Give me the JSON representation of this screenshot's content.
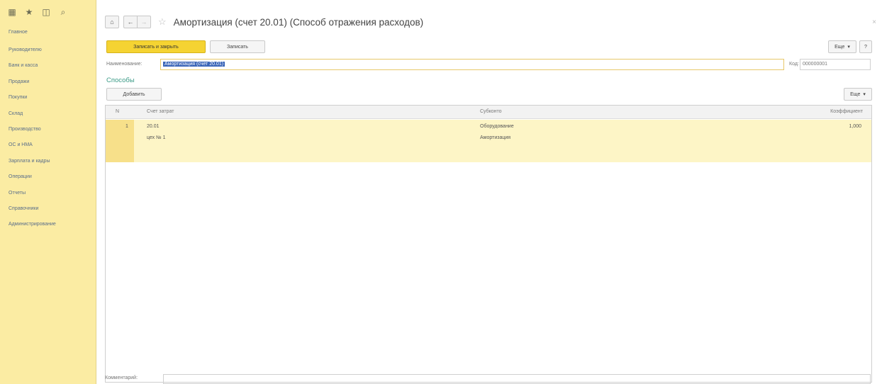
{
  "sidebar": {
    "items": [
      {
        "label": "Главное"
      },
      {
        "label": "Руководителю"
      },
      {
        "label": "Банк и касса"
      },
      {
        "label": "Продажи"
      },
      {
        "label": "Покупки"
      },
      {
        "label": "Склад"
      },
      {
        "label": "Производство"
      },
      {
        "label": "ОС и НМА"
      },
      {
        "label": "Зарплата и кадры"
      },
      {
        "label": "Операции"
      },
      {
        "label": "Отчеты"
      },
      {
        "label": "Справочники"
      },
      {
        "label": "Администрирование"
      }
    ]
  },
  "header": {
    "title": "Амортизация (счет 20.01) (Способ отражения расходов)",
    "home_glyph": "⌂",
    "back_glyph": "←",
    "forward_glyph": "→",
    "star_glyph": "☆",
    "close_glyph": "×"
  },
  "toolbar": {
    "save_close_label": "Записать и закрыть",
    "save_label": "Записать",
    "more_label": "Еще",
    "more_arrow": "▾",
    "help_label": "?"
  },
  "form": {
    "name_label": "Наименование:",
    "name_value": "Амортизация (счет 20.01)",
    "code_label": "Код:",
    "code_value": "000000001"
  },
  "methods": {
    "section_title": "Способы",
    "add_label": "Добавить",
    "more_label": "Еще",
    "columns": {
      "n": "N",
      "account": "Счет затрат",
      "subconto": "Субконто",
      "coefficient": "Коэффициент"
    },
    "rows": [
      {
        "n": "1",
        "account": "20.01",
        "account_sub": "цех № 1",
        "subconto1": "Оборудование",
        "subconto2": "Амортизация",
        "coefficient": "1,000"
      }
    ]
  },
  "footer": {
    "comment_label": "Комментарий:"
  }
}
